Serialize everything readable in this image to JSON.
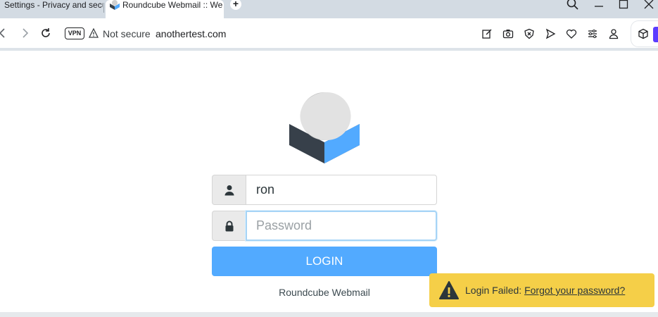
{
  "browser": {
    "inactive_tab_title": "Settings - Privacy and secu",
    "active_tab_title": "Roundcube Webmail :: We",
    "new_tab_label": "+",
    "vpn_label": "VPN",
    "security_status": "Not secure",
    "url": "anothertest.com"
  },
  "login": {
    "username_value": "ron",
    "password_placeholder": "Password",
    "login_button_label": "LOGIN",
    "product_name": "Roundcube Webmail"
  },
  "toast": {
    "message": "Login Failed:",
    "link_text": "Forgot your password?"
  },
  "colors": {
    "primary": "#52aaff",
    "warning": "#f5cf48",
    "logo_dark": "#37404a",
    "logo_blue": "#52aaff"
  },
  "icons": [
    "back-icon",
    "forward-icon",
    "reload-icon",
    "warning-icon",
    "edit-icon",
    "camera-icon",
    "shield-icon",
    "send-icon",
    "heart-icon",
    "menu-icon",
    "profile-icon",
    "extensions-icon",
    "user-icon",
    "lock-icon",
    "search-icon",
    "minimize-icon",
    "maximize-icon",
    "close-icon"
  ]
}
